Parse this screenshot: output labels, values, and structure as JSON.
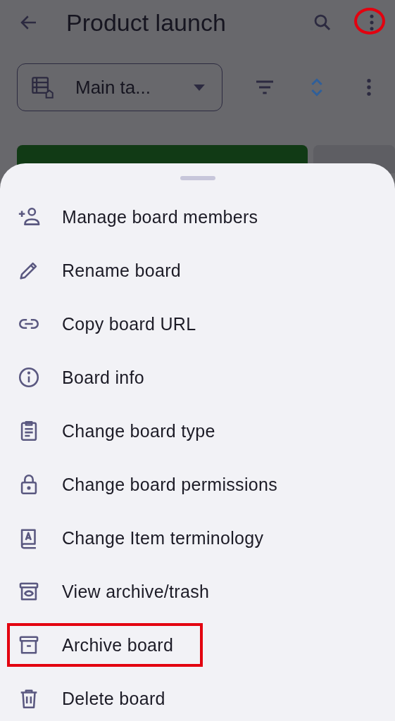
{
  "app_bar": {
    "title": "Product launch",
    "more_highlighted": true
  },
  "view_selector": {
    "label": "Main ta..."
  },
  "menu": [
    {
      "label": "Manage board members",
      "kind": "add-person",
      "highlighted": false
    },
    {
      "label": "Rename board",
      "kind": "pencil",
      "highlighted": false
    },
    {
      "label": "Copy board URL",
      "kind": "link",
      "highlighted": false
    },
    {
      "label": "Board info",
      "kind": "info",
      "highlighted": false
    },
    {
      "label": "Change board type",
      "kind": "clipboard",
      "highlighted": false
    },
    {
      "label": "Change board permissions",
      "kind": "lock",
      "highlighted": false
    },
    {
      "label": "Change Item terminology",
      "kind": "book",
      "highlighted": false
    },
    {
      "label": "View archive/trash",
      "kind": "archive-eye",
      "highlighted": false
    },
    {
      "label": "Archive board",
      "kind": "archive",
      "highlighted": true
    },
    {
      "label": "Delete board",
      "kind": "trash",
      "highlighted": false
    }
  ]
}
